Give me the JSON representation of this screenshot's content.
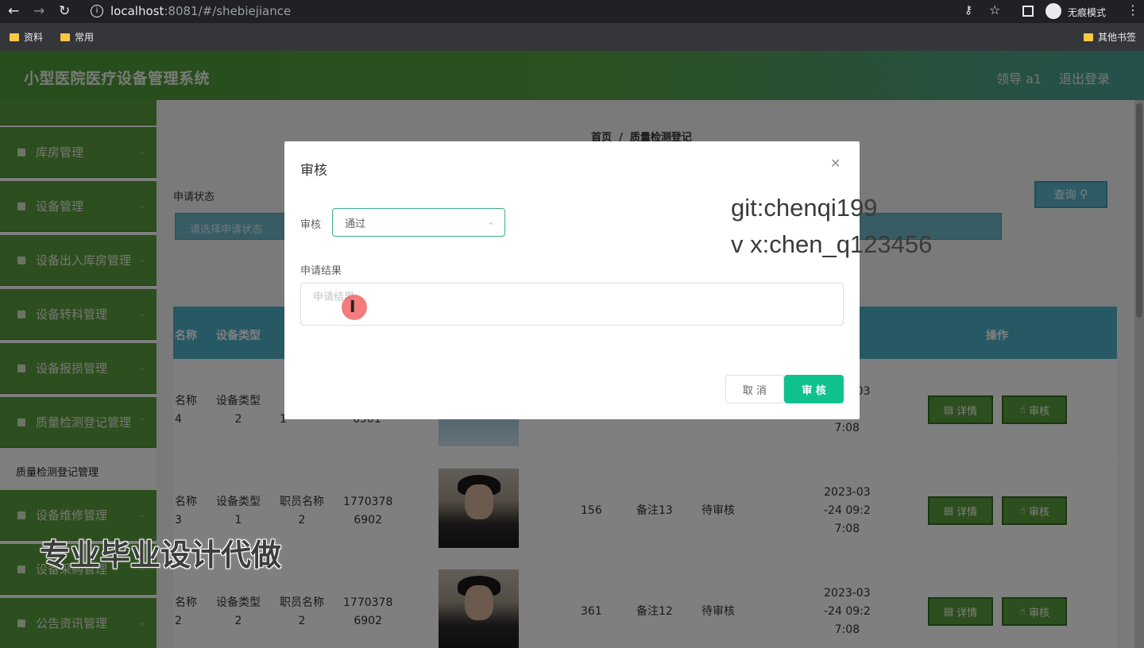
{
  "browser": {
    "url_host": "localhost",
    "url_rest": ":8081/#/shebiejiance",
    "incognito_label": "无痕模式",
    "bookmarks": [
      "资料",
      "常用"
    ],
    "other_bookmarks": "其他书签"
  },
  "header": {
    "title": "小型医院医疗设备管理系统",
    "user": "领导 a1",
    "logout": "退出登录"
  },
  "sidebar": {
    "items": [
      {
        "label": "库房管理"
      },
      {
        "label": "设备管理"
      },
      {
        "label": "设备出入库房管理"
      },
      {
        "label": "设备转科管理"
      },
      {
        "label": "设备报损管理"
      },
      {
        "label": "质量检测登记管理"
      },
      {
        "label": "设备维修管理"
      },
      {
        "label": "设备采购管理"
      },
      {
        "label": "公告资讯管理"
      }
    ],
    "active_sub": "质量检测登记管理"
  },
  "main": {
    "breadcrumb_home": "首页",
    "breadcrumb_sep": "/",
    "breadcrumb_current": "质量检测登记",
    "filter_label": "申请状态",
    "filter_placeholder": "请选择申请状态",
    "search_button": "查询",
    "table_headers": [
      "名称",
      "设备类型",
      "操作"
    ],
    "detail_button": "详情",
    "review_button": "审核",
    "rows": [
      {
        "name": "名称\n4",
        "type": "设备类型\n2",
        "staff": "\n1",
        "phone": "6901",
        "num": "",
        "remark": "",
        "status": "",
        "time": "2023-03\n2\n7:08"
      },
      {
        "name": "名称\n3",
        "type": "设备类型\n1",
        "staff": "职员名称\n2",
        "phone": "1770378\n6902",
        "num": "156",
        "remark": "备注13",
        "status": "待审核",
        "time": "2023-03\n-24 09:2\n7:08"
      },
      {
        "name": "名称\n2",
        "type": "设备类型\n2",
        "staff": "职员名称\n2",
        "phone": "1770378\n6902",
        "num": "361",
        "remark": "备注12",
        "status": "待审核",
        "time": "2023-03\n-24 09:2\n7:08"
      }
    ]
  },
  "dialog": {
    "title": "审核",
    "review_label": "审核",
    "review_value": "通过",
    "result_label": "申请结果",
    "result_placeholder": "申请结果",
    "cancel": "取 消",
    "confirm": "审 核"
  },
  "watermark": {
    "line1": "git:chenqi199",
    "line2": "v x:chen_q123456",
    "bottom": "专业毕业设计代做"
  }
}
